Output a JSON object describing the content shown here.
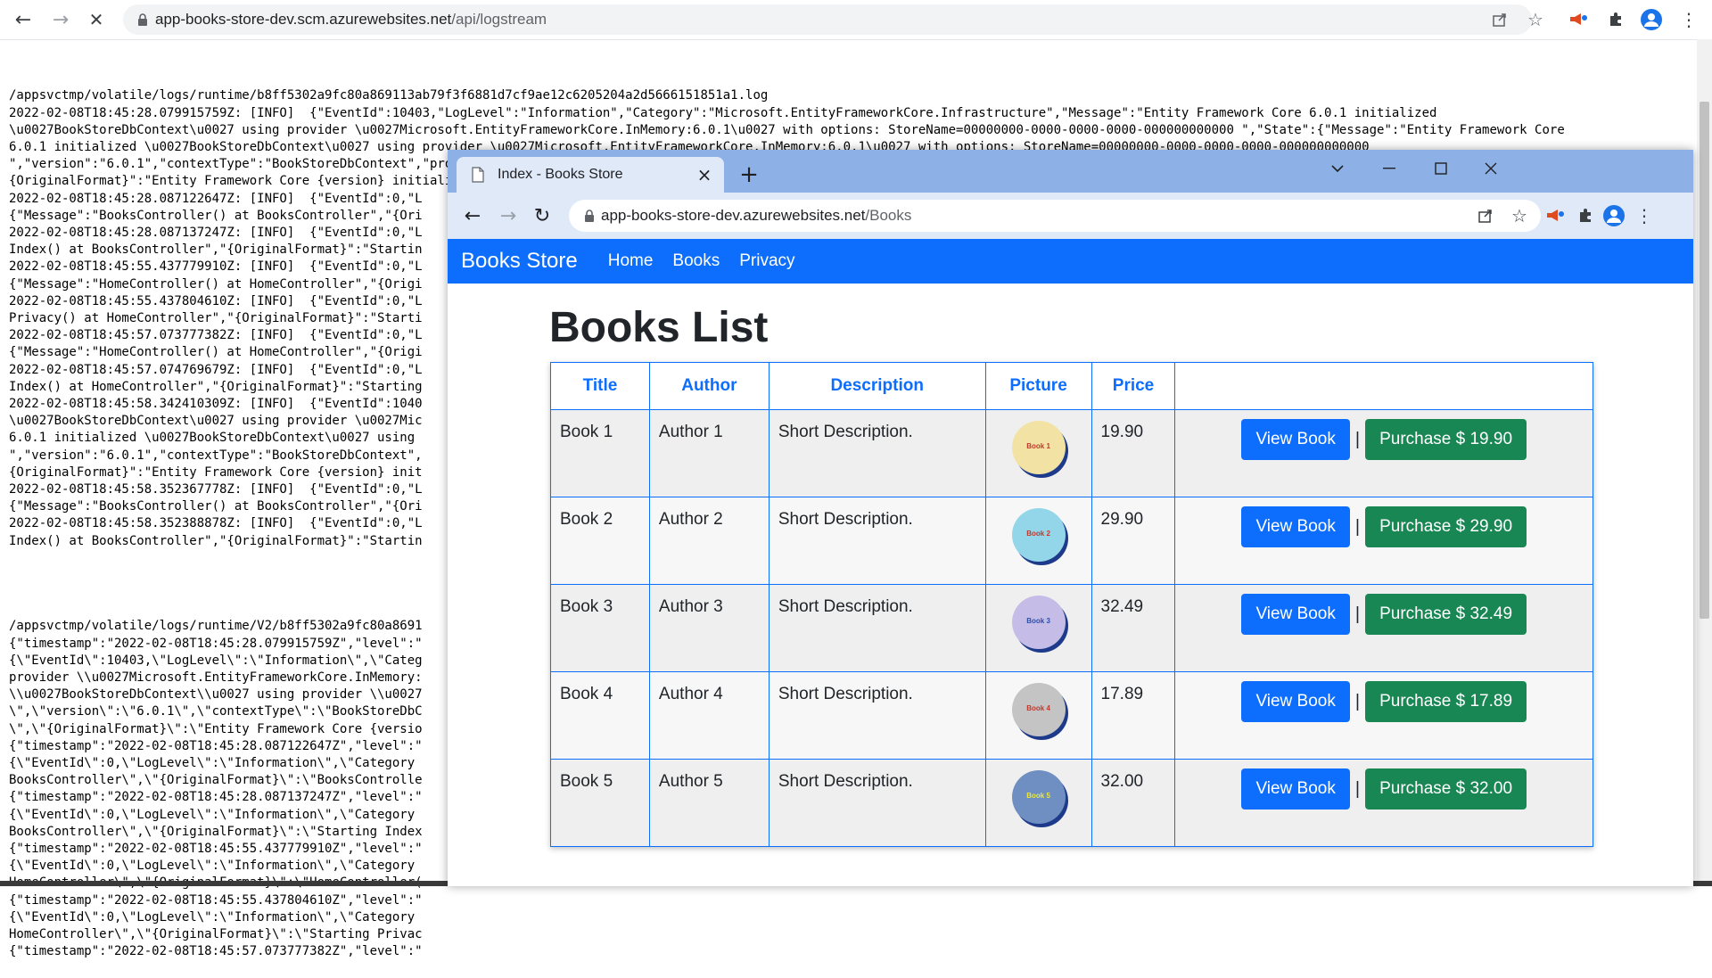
{
  "background_browser": {
    "url_host": "app-books-store-dev.scm.azurewebsites.net",
    "url_path": "/api/logstream"
  },
  "log": {
    "block1": [
      "/appsvctmp/volatile/logs/runtime/b8ff5302a9fc80a869113ab79f3f6881d7cf9ae12c6205204a2d5666151851a1.log",
      "2022-02-08T18:45:28.079915759Z: [INFO]  {\"EventId\":10403,\"LogLevel\":\"Information\",\"Category\":\"Microsoft.EntityFrameworkCore.Infrastructure\",\"Message\":\"Entity Framework Core 6.0.1 initialized",
      "\\u0027BookStoreDbContext\\u0027 using provider \\u0027Microsoft.EntityFrameworkCore.InMemory:6.0.1\\u0027 with options: StoreName=00000000-0000-0000-0000-000000000000 \",\"State\":{\"Message\":\"Entity Framework Core",
      "6.0.1 initialized \\u0027BookStoreDbContext\\u0027 using provider \\u0027Microsoft.EntityFrameworkCore.InMemory:6.0.1\\u0027 with options: StoreName=00000000-0000-0000-0000-000000000000",
      "\",\"version\":\"6.0.1\",\"contextType\":\"BookStoreDbContext\",\"provider\":\"Microsoft.EntityFrameworkCore.InMemory\",\"providerVersion\":\"6.0.1\",\"options\":\"StoreName=00000000-0000-0000-0000-000000000000 \",\"",
      "{OriginalFormat}\":\"Entity Framework Core {version} initialized \\u0027{contextType}\\u0027 using provider \\u0027{provider}\\u0027 with options: {options}\"}}",
      "2022-02-08T18:45:28.087122647Z: [INFO]  {\"EventId\":0,\"L",
      "{\"Message\":\"BooksController() at BooksController\",\"{Ori",
      "2022-02-08T18:45:28.087137247Z: [INFO]  {\"EventId\":0,\"L",
      "Index() at BooksController\",\"{OriginalFormat}\":\"Startin",
      "2022-02-08T18:45:55.437779910Z: [INFO]  {\"EventId\":0,\"L",
      "{\"Message\":\"HomeController() at HomeController\",\"{Origi",
      "2022-02-08T18:45:55.437804610Z: [INFO]  {\"EventId\":0,\"L",
      "Privacy() at HomeController\",\"{OriginalFormat}\":\"Starti",
      "2022-02-08T18:45:57.073777382Z: [INFO]  {\"EventId\":0,\"L",
      "{\"Message\":\"HomeController() at HomeController\",\"{Origi",
      "2022-02-08T18:45:57.074769679Z: [INFO]  {\"EventId\":0,\"L",
      "Index() at HomeController\",\"{OriginalFormat}\":\"Starting",
      "2022-02-08T18:45:58.342410309Z: [INFO]  {\"EventId\":1040",
      "\\u0027BookStoreDbContext\\u0027 using provider \\u0027Mic",
      "6.0.1 initialized \\u0027BookStoreDbContext\\u0027 using",
      "\",\"version\":\"6.0.1\",\"contextType\":\"BookStoreDbContext\",",
      "{OriginalFormat}\":\"Entity Framework Core {version} init",
      "2022-02-08T18:45:58.352367778Z: [INFO]  {\"EventId\":0,\"L",
      "{\"Message\":\"BooksController() at BooksController\",\"{Ori",
      "2022-02-08T18:45:58.352388878Z: [INFO]  {\"EventId\":0,\"L",
      "Index() at BooksController\",\"{OriginalFormat}\":\"Startin"
    ],
    "block2": [
      "/appsvctmp/volatile/logs/runtime/V2/b8ff5302a9fc80a8691",
      "{\"timestamp\":\"2022-02-08T18:45:28.079915759Z\",\"level\":\"",
      "{\\\"EventId\\\":10403,\\\"LogLevel\\\":\\\"Information\\\",\\\"Categ",
      "provider \\\\u0027Microsoft.EntityFrameworkCore.InMemory:",
      "\\\\u0027BookStoreDbContext\\\\u0027 using provider \\\\u0027",
      "\\\",\\\"version\\\":\\\"6.0.1\\\",\\\"contextType\\\":\\\"BookStoreDbC",
      "\\\",\\\"{OriginalFormat}\\\":\\\"Entity Framework Core {versio",
      "{\"timestamp\":\"2022-02-08T18:45:28.087122647Z\",\"level\":\"",
      "{\\\"EventId\\\":0,\\\"LogLevel\\\":\\\"Information\\\",\\\"Category",
      "BooksController\\\",\\\"{OriginalFormat}\\\":\\\"BooksControlle",
      "{\"timestamp\":\"2022-02-08T18:45:28.087137247Z\",\"level\":\"",
      "{\\\"EventId\\\":0,\\\"LogLevel\\\":\\\"Information\\\",\\\"Category",
      "BooksController\\\",\\\"{OriginalFormat}\\\":\\\"Starting Index",
      "{\"timestamp\":\"2022-02-08T18:45:55.437779910Z\",\"level\":\"",
      "{\\\"EventId\\\":0,\\\"LogLevel\\\":\\\"Information\\\",\\\"Category",
      "HomeController\\\",\\\"{OriginalFormat}\\\":\\\"HomeController(",
      "{\"timestamp\":\"2022-02-08T18:45:55.437804610Z\",\"level\":\"",
      "{\\\"EventId\\\":0,\\\"LogLevel\\\":\\\"Information\\\",\\\"Category",
      "HomeController\\\",\\\"{OriginalFormat}\\\":\\\"Starting Privac",
      "{\"timestamp\":\"2022-02-08T18:45:57.073777382Z\",\"level\":\""
    ]
  },
  "front_browser": {
    "tab_title": "Index - Books Store",
    "url_host": "app-books-store-dev.azurewebsites.net",
    "url_path": "/Books"
  },
  "site": {
    "brand": "Books Store",
    "nav": [
      "Home",
      "Books",
      "Privacy"
    ],
    "page_title": "Books List",
    "columns": [
      "Title",
      "Author",
      "Description",
      "Picture",
      "Price",
      ""
    ],
    "view_label": "View Book",
    "separator": "|",
    "books": [
      {
        "title": "Book 1",
        "author": "Author 1",
        "description": "Short Description.",
        "cover_label": "Book 1",
        "cover_color": "#f2e3a4",
        "cover_text_color": "#c0392b",
        "price": "19.90",
        "purchase_label": "Purchase $ 19.90"
      },
      {
        "title": "Book 2",
        "author": "Author 2",
        "description": "Short Description.",
        "cover_label": "Book 2",
        "cover_color": "#93d6ea",
        "cover_text_color": "#c0392b",
        "price": "29.90",
        "purchase_label": "Purchase $ 29.90"
      },
      {
        "title": "Book 3",
        "author": "Author 3",
        "description": "Short Description.",
        "cover_label": "Book 3",
        "cover_color": "#c5bde8",
        "cover_text_color": "#2e4ea8",
        "price": "32.49",
        "purchase_label": "Purchase $ 32.49"
      },
      {
        "title": "Book 4",
        "author": "Author 4",
        "description": "Short Description.",
        "cover_label": "Book 4",
        "cover_color": "#c4c4c4",
        "cover_text_color": "#c0392b",
        "price": "17.89",
        "purchase_label": "Purchase $ 17.89"
      },
      {
        "title": "Book 5",
        "author": "Author 5",
        "description": "Short Description.",
        "cover_label": "Book 5",
        "cover_color": "#6f8fc2",
        "cover_text_color": "#e8e840",
        "price": "32.00",
        "purchase_label": "Purchase $ 32.00"
      }
    ]
  },
  "colors": {
    "primary": "#0d6efd",
    "success": "#198754",
    "titlebar": "#8db1e6"
  }
}
